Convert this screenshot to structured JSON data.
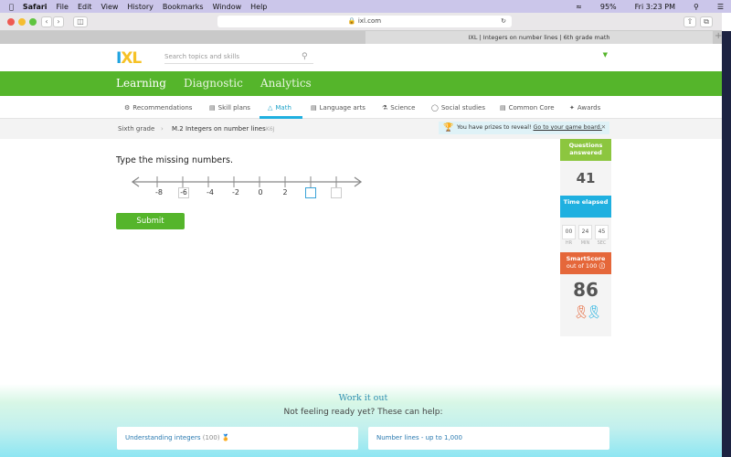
{
  "menubar": {
    "app": "Safari",
    "items": [
      "File",
      "Edit",
      "View",
      "History",
      "Bookmarks",
      "Window",
      "Help"
    ],
    "battery": "95%",
    "clock": "Fri 3:23 PM"
  },
  "browser": {
    "url": "ixl.com",
    "tab_title": "IXL | Integers on number lines | 6th grade math"
  },
  "header": {
    "logo": "IXL",
    "search_placeholder": "Search topics and skills"
  },
  "nav": {
    "items": [
      "Learning",
      "Diagnostic",
      "Analytics"
    ],
    "active": "Learning"
  },
  "subnav": {
    "items": [
      "Recommendations",
      "Skill plans",
      "Math",
      "Language arts",
      "Science",
      "Social studies",
      "Common Core",
      "Awards"
    ],
    "active": "Math"
  },
  "breadcrumb": {
    "grade": "Sixth grade",
    "skill": "M.2 Integers on number lines",
    "code": "K6J"
  },
  "prize": {
    "text": "You have prizes to reveal!",
    "link": "Go to your game board."
  },
  "question": {
    "prompt": "Type the missing numbers.",
    "labels": [
      "-8",
      "-6",
      "-4",
      "-2",
      "0",
      "2"
    ],
    "entered": "-6",
    "submit": "Submit"
  },
  "stats": {
    "questions_label": "Questions answered",
    "questions": "41",
    "time_label": "Time elapsed",
    "hr": "00",
    "min": "24",
    "sec": "45",
    "hr_label": "HR",
    "min_label": "MIN",
    "sec_label": "SEC",
    "score_label": "SmartScore",
    "score_sub": "out of 100",
    "score": "86"
  },
  "help": {
    "title": "Work it out",
    "subtitle": "Not feeling ready yet? These can help:",
    "links": [
      {
        "label": "Understanding integers",
        "count": "(100)"
      },
      {
        "label": "Number lines - up to 1,000"
      }
    ]
  },
  "colors": {
    "green": "#55b52b",
    "blue": "#1fb0e0",
    "orange": "#e5673a"
  }
}
